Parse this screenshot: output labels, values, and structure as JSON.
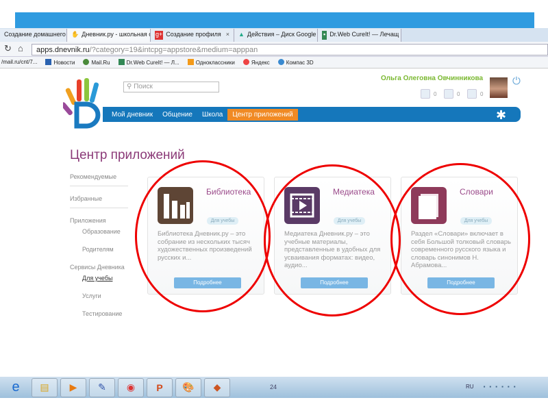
{
  "browser": {
    "tabs": [
      {
        "label": "Создание домашнего за"
      },
      {
        "label": "Дневник.ру - школьная с"
      },
      {
        "label": "Создание профиля"
      },
      {
        "label": "Действия – Диск Google"
      },
      {
        "label": "Dr.Web CureIt! — Лечащ"
      }
    ],
    "close": "×",
    "url_host": "apps.dnevnik.ru",
    "url_rest": "/?category=19&intcpg=appstore&medium=apppan",
    "bookmarks": [
      "/mail.ru/cnt/7...",
      "Новости",
      "Mail.Ru",
      "Dr.Web CureIt! — Л...",
      "Одноклассники",
      "Яндекс",
      "Компас 3D"
    ]
  },
  "header": {
    "search_placeholder": "Поиск",
    "user_name": "Ольга Олеговна Овчинникова",
    "counts": [
      "0",
      "0",
      "0"
    ]
  },
  "nav": {
    "items": [
      "Мой дневник",
      "Общение",
      "Школа",
      "Центр приложений"
    ]
  },
  "page_title": "Центр приложений",
  "sidebar": {
    "recommended": "Рекомендуемые",
    "favorites": "Избранные",
    "apps": "Приложения",
    "apps_sub": [
      "Образование",
      "Родителям"
    ],
    "services": "Сервисы Дневника",
    "services_sub": [
      "Для учебы",
      "Услуги",
      "Тестирование"
    ]
  },
  "cards": [
    {
      "name": "Библиотека",
      "badge": "Для учебы",
      "desc": "Библиотека Дневник.ру – это собрание из нескольких тысяч художественных произведений русских и...",
      "button": "Подробнее",
      "color": "#5e4535"
    },
    {
      "name": "Медиатека",
      "badge": "Для учебы",
      "desc": "Медиатека Дневник.ру – это учебные материалы, представленные в удобных для усваивания форматах: видео, аудио...",
      "button": "Подробнее",
      "color": "#5a3a66"
    },
    {
      "name": "Словари",
      "badge": "Для учебы",
      "desc": "Раздел «Словари» включает в себя Большой толковый словарь современного русского языка и словарь синонимов Н. Абрамова...",
      "button": "Подробнее",
      "color": "#8e3a5a"
    }
  ],
  "taskbar": {
    "page": "24",
    "lang": "RU"
  }
}
